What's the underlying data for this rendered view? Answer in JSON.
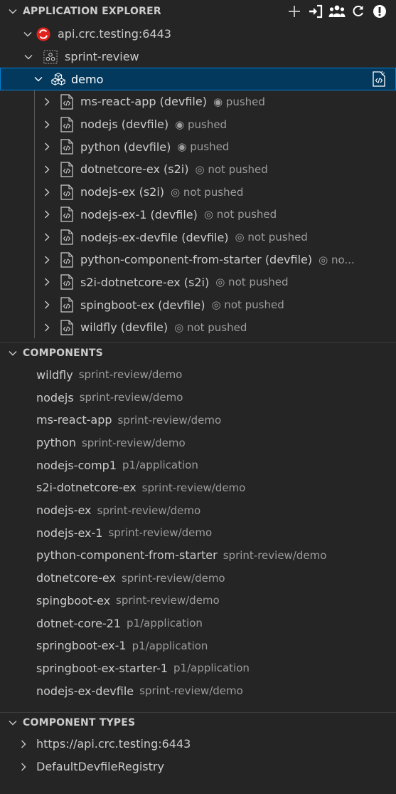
{
  "colors": {
    "background": "#252526",
    "selection": "#04395e",
    "selection_border": "#007fd4",
    "cluster_icon_red": "#e0221d",
    "text": "#cccccc",
    "description": "#9d9d9d"
  },
  "explorer": {
    "title": "APPLICATION EXPLORER",
    "actions": [
      {
        "icon": "add-icon"
      },
      {
        "icon": "login-icon"
      },
      {
        "icon": "users-icon"
      },
      {
        "icon": "refresh-icon"
      },
      {
        "icon": "info-icon"
      }
    ],
    "cluster": {
      "label": "api.crc.testing:6443",
      "icon": "openshift-cluster-icon"
    },
    "project": {
      "label": "sprint-review",
      "icon": "project-icon"
    },
    "application": {
      "label": "demo",
      "icon": "application-icon",
      "action_icon": "deploy-devfile-icon"
    },
    "components": [
      {
        "label": "ms-react-app (devfile)",
        "status": "◉ pushed"
      },
      {
        "label": "nodejs (devfile)",
        "status": "◉ pushed"
      },
      {
        "label": "python (devfile)",
        "status": "◉ pushed"
      },
      {
        "label": "dotnetcore-ex (s2i)",
        "status": "◎ not pushed"
      },
      {
        "label": "nodejs-ex (s2i)",
        "status": "◎ not pushed"
      },
      {
        "label": "nodejs-ex-1 (devfile)",
        "status": "◎ not pushed"
      },
      {
        "label": "nodejs-ex-devfile (devfile)",
        "status": "◎ not pushed"
      },
      {
        "label": "python-component-from-starter (devfile)",
        "status": "◎ no..."
      },
      {
        "label": "s2i-dotnetcore-ex (s2i)",
        "status": "◎ not pushed"
      },
      {
        "label": "spingboot-ex (devfile)",
        "status": "◎ not pushed"
      },
      {
        "label": "wildfly (devfile)",
        "status": "◎ not pushed"
      }
    ]
  },
  "components_section": {
    "title": "COMPONENTS",
    "items": [
      {
        "name": "wildfly",
        "path": "sprint-review/demo"
      },
      {
        "name": "nodejs",
        "path": "sprint-review/demo"
      },
      {
        "name": "ms-react-app",
        "path": "sprint-review/demo"
      },
      {
        "name": "python",
        "path": "sprint-review/demo"
      },
      {
        "name": "nodejs-comp1",
        "path": "p1/application"
      },
      {
        "name": "s2i-dotnetcore-ex",
        "path": "sprint-review/demo"
      },
      {
        "name": "nodejs-ex",
        "path": "sprint-review/demo"
      },
      {
        "name": "nodejs-ex-1",
        "path": "sprint-review/demo"
      },
      {
        "name": "python-component-from-starter",
        "path": "sprint-review/demo"
      },
      {
        "name": "dotnetcore-ex",
        "path": "sprint-review/demo"
      },
      {
        "name": "spingboot-ex",
        "path": "sprint-review/demo"
      },
      {
        "name": "dotnet-core-21",
        "path": "p1/application"
      },
      {
        "name": "springboot-ex-1",
        "path": "p1/application"
      },
      {
        "name": "springboot-ex-starter-1",
        "path": "p1/application"
      },
      {
        "name": "nodejs-ex-devfile",
        "path": "sprint-review/demo"
      }
    ]
  },
  "component_types_section": {
    "title": "COMPONENT TYPES",
    "items": [
      {
        "label": "https://api.crc.testing:6443"
      },
      {
        "label": "DefaultDevfileRegistry"
      }
    ]
  }
}
